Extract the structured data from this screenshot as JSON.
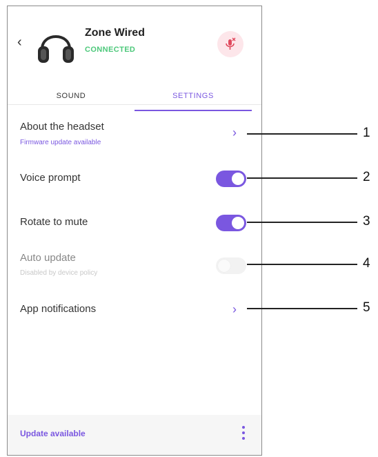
{
  "header": {
    "back_glyph": "‹",
    "device_name": "Zone Wired",
    "status": "CONNECTED"
  },
  "tabs": [
    {
      "label": "SOUND",
      "active": false
    },
    {
      "label": "SETTINGS",
      "active": true
    }
  ],
  "settings": {
    "about": {
      "label": "About the headset",
      "subtitle": "Firmware update available"
    },
    "voice_prompt": {
      "label": "Voice prompt",
      "enabled": true
    },
    "rotate_to_mute": {
      "label": "Rotate to mute",
      "enabled": true
    },
    "auto_update": {
      "label": "Auto update",
      "subtitle": "Disabled by device policy",
      "enabled": false
    },
    "app_notifications": {
      "label": "App notifications"
    }
  },
  "footer": {
    "label": "Update available"
  },
  "callouts": [
    "1",
    "2",
    "3",
    "4",
    "5"
  ],
  "colors": {
    "accent": "#7a57e0",
    "connected": "#4cc87a",
    "mute_bg": "#fde6ea",
    "mute_icon": "#e04a5e"
  }
}
